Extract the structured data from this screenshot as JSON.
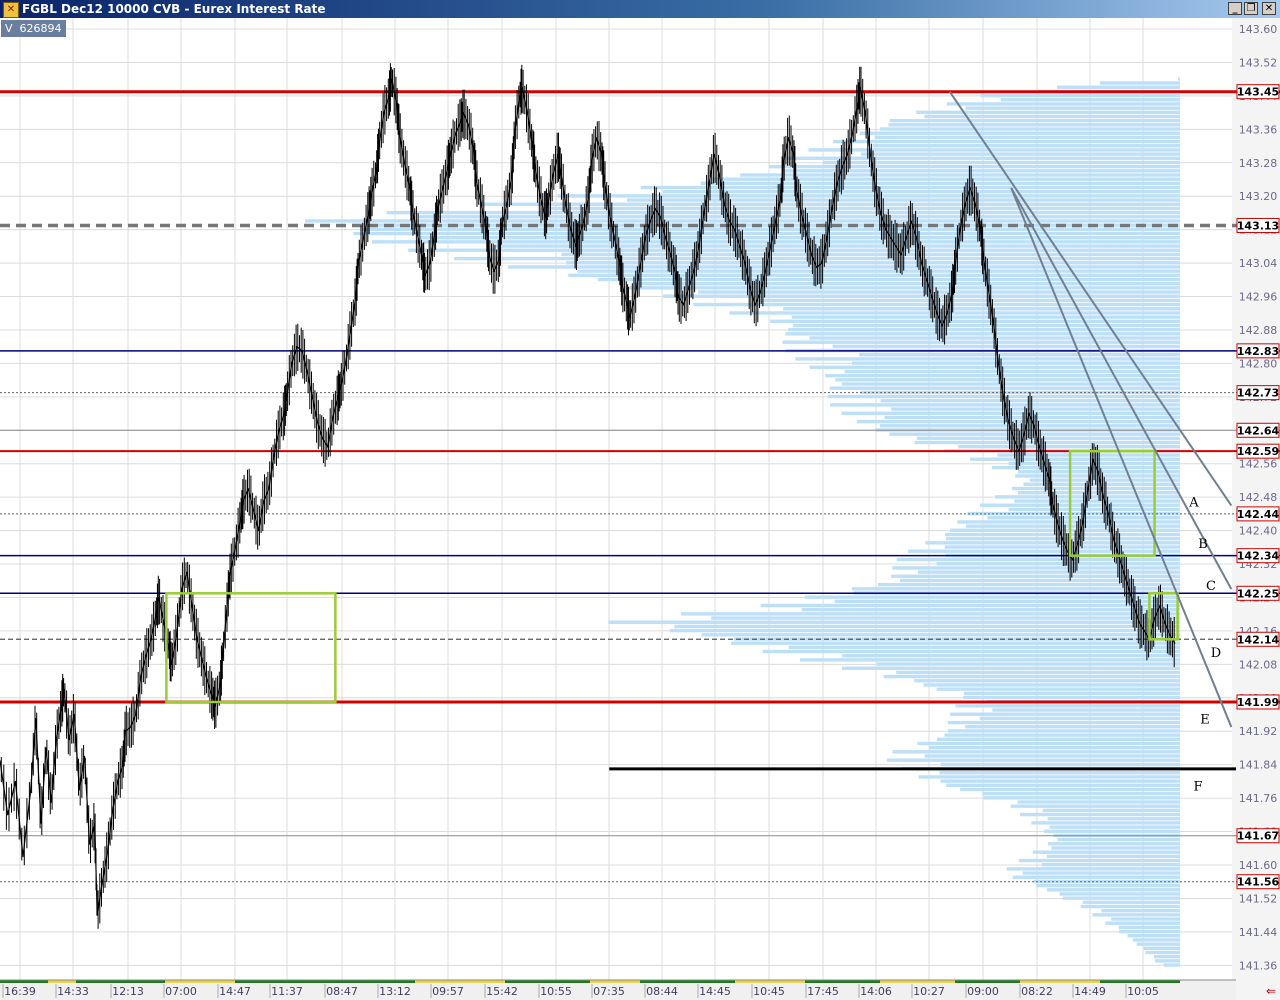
{
  "window": {
    "title": "FGBL Dec12 10000 CVB - Eurex Interest Rate",
    "buttons": {
      "minimize": "_",
      "restore": "❐",
      "close": "✕"
    }
  },
  "volume_badge": {
    "label": "V",
    "value": "626894"
  },
  "colors": {
    "grid": "#dcdcdc",
    "price": "#000000",
    "profile": "#bde0f8",
    "red_line": "#d40000",
    "blue_line": "#000080",
    "box": "#9acd32",
    "trend": "#708090",
    "tag_bg": "#ffffff",
    "tag_border": "#cc0000",
    "time_green": "#1e7b1e",
    "time_yellow": "#e8d44d"
  },
  "chart_data": {
    "type": "line",
    "symbol": "FGBL Dec12",
    "bar_type": "10000 CVB",
    "ylim": [
      141.31,
      143.63
    ],
    "y_ticks": [
      143.6,
      143.52,
      143.44,
      143.36,
      143.28,
      143.2,
      143.12,
      143.04,
      142.96,
      142.88,
      142.8,
      142.72,
      142.64,
      142.56,
      142.48,
      142.4,
      142.32,
      142.24,
      142.16,
      142.08,
      142.0,
      141.92,
      141.84,
      141.76,
      141.68,
      141.6,
      141.52,
      141.44,
      141.36
    ],
    "y_tick_labels": [
      "143.60",
      "143.52",
      "143.44",
      "143.36",
      "143.28",
      "143.20",
      "143.12",
      "143.04",
      "142.96",
      "142.88",
      "142.80",
      "142.72",
      "142.64",
      "142.56",
      "142.48",
      "142.40",
      "142.32",
      "142.24",
      "142.16",
      "142.08",
      "142.00",
      "141.92",
      "141.84",
      "141.76",
      "141.68",
      "141.60",
      "141.52",
      "141.44",
      "141.36"
    ],
    "x_labels": [
      "16:39",
      "14:33",
      "12:13",
      "07:00",
      "14:47",
      "11:37",
      "08:47",
      "13:12",
      "09:57",
      "15:42",
      "10:55",
      "07:35",
      "08:44",
      "14:45",
      "10:45",
      "17:45",
      "14:06",
      "10:27",
      "09:00",
      "08:22",
      "14:49",
      "10:05"
    ],
    "price_path": [
      [
        0,
        141.85
      ],
      [
        3,
        141.72
      ],
      [
        6,
        141.8
      ],
      [
        9,
        141.62
      ],
      [
        12,
        141.78
      ],
      [
        14,
        141.95
      ],
      [
        16,
        141.7
      ],
      [
        18,
        141.88
      ],
      [
        20,
        141.75
      ],
      [
        22,
        141.9
      ],
      [
        24,
        141.98
      ],
      [
        25,
        142.02
      ],
      [
        27,
        141.9
      ],
      [
        29,
        141.96
      ],
      [
        31,
        141.78
      ],
      [
        33,
        141.86
      ],
      [
        35,
        141.65
      ],
      [
        37,
        141.7
      ],
      [
        38,
        141.48
      ],
      [
        40,
        141.56
      ],
      [
        42,
        141.63
      ],
      [
        44,
        141.73
      ],
      [
        46,
        141.8
      ],
      [
        48,
        141.84
      ],
      [
        49,
        141.92
      ],
      [
        51,
        141.93
      ],
      [
        53,
        141.96
      ],
      [
        55,
        142.05
      ],
      [
        57,
        142.1
      ],
      [
        59,
        142.14
      ],
      [
        61,
        142.2
      ],
      [
        62,
        142.24
      ],
      [
        64,
        142.18
      ],
      [
        66,
        142.12
      ],
      [
        67,
        142.08
      ],
      [
        69,
        142.15
      ],
      [
        71,
        142.26
      ],
      [
        73,
        142.3
      ],
      [
        75,
        142.22
      ],
      [
        77,
        142.14
      ],
      [
        79,
        142.09
      ],
      [
        81,
        142.04
      ],
      [
        83,
        142.0
      ],
      [
        84,
        141.98
      ],
      [
        86,
        142.03
      ],
      [
        87,
        142.1
      ],
      [
        89,
        142.24
      ],
      [
        90,
        142.3
      ],
      [
        92,
        142.36
      ],
      [
        94,
        142.43
      ],
      [
        95,
        142.47
      ],
      [
        97,
        142.5
      ],
      [
        99,
        142.45
      ],
      [
        101,
        142.4
      ],
      [
        103,
        142.47
      ],
      [
        105,
        142.5
      ],
      [
        107,
        142.58
      ],
      [
        109,
        142.64
      ],
      [
        111,
        142.68
      ],
      [
        112,
        142.72
      ],
      [
        114,
        142.8
      ],
      [
        116,
        142.84
      ],
      [
        118,
        142.83
      ],
      [
        120,
        142.78
      ],
      [
        122,
        142.72
      ],
      [
        124,
        142.66
      ],
      [
        126,
        142.62
      ],
      [
        128,
        142.6
      ],
      [
        130,
        142.67
      ],
      [
        132,
        142.72
      ],
      [
        133,
        142.74
      ],
      [
        135,
        142.8
      ],
      [
        137,
        142.88
      ],
      [
        139,
        142.96
      ],
      [
        140,
        143.04
      ],
      [
        142,
        143.1
      ],
      [
        144,
        143.16
      ],
      [
        145,
        143.2
      ],
      [
        147,
        143.26
      ],
      [
        148,
        143.32
      ],
      [
        150,
        143.4
      ],
      [
        152,
        143.44
      ],
      [
        153,
        143.48
      ],
      [
        155,
        143.42
      ],
      [
        156,
        143.35
      ],
      [
        158,
        143.28
      ],
      [
        160,
        143.22
      ],
      [
        161,
        143.17
      ],
      [
        163,
        143.11
      ],
      [
        165,
        143.05
      ],
      [
        166,
        143.01
      ],
      [
        168,
        143.04
      ],
      [
        170,
        143.12
      ],
      [
        171,
        143.17
      ],
      [
        173,
        143.22
      ],
      [
        175,
        143.27
      ],
      [
        176,
        143.3
      ],
      [
        178,
        143.35
      ],
      [
        180,
        143.38
      ],
      [
        181,
        143.4
      ],
      [
        183,
        143.37
      ],
      [
        185,
        143.31
      ],
      [
        186,
        143.24
      ],
      [
        188,
        143.18
      ],
      [
        190,
        143.12
      ],
      [
        191,
        143.06
      ],
      [
        193,
        143.02
      ],
      [
        195,
        143.05
      ],
      [
        196,
        143.13
      ],
      [
        198,
        143.18
      ],
      [
        200,
        143.25
      ],
      [
        201,
        143.35
      ],
      [
        203,
        143.44
      ],
      [
        204,
        143.46
      ],
      [
        206,
        143.4
      ],
      [
        208,
        143.32
      ],
      [
        209,
        143.27
      ],
      [
        211,
        143.2
      ],
      [
        213,
        143.15
      ],
      [
        214,
        143.18
      ],
      [
        216,
        143.25
      ],
      [
        218,
        143.3
      ],
      [
        219,
        143.26
      ],
      [
        221,
        143.18
      ],
      [
        223,
        143.12
      ],
      [
        225,
        143.08
      ],
      [
        226,
        143.1
      ],
      [
        228,
        143.14
      ],
      [
        230,
        143.2
      ],
      [
        231,
        143.28
      ],
      [
        233,
        143.34
      ],
      [
        235,
        143.3
      ],
      [
        236,
        143.24
      ],
      [
        238,
        143.16
      ],
      [
        240,
        143.1
      ],
      [
        242,
        143.04
      ],
      [
        243,
        142.99
      ],
      [
        245,
        142.94
      ],
      [
        246,
        142.91
      ],
      [
        248,
        142.96
      ],
      [
        250,
        143.03
      ],
      [
        252,
        143.1
      ],
      [
        254,
        143.14
      ],
      [
        256,
        143.17
      ],
      [
        258,
        143.15
      ],
      [
        260,
        143.1
      ],
      [
        262,
        143.06
      ],
      [
        264,
        143.01
      ],
      [
        265,
        142.96
      ],
      [
        267,
        142.94
      ],
      [
        269,
        142.98
      ],
      [
        271,
        143.02
      ],
      [
        273,
        143.08
      ],
      [
        275,
        143.16
      ],
      [
        277,
        143.23
      ],
      [
        279,
        143.3
      ],
      [
        281,
        143.25
      ],
      [
        283,
        143.18
      ],
      [
        285,
        143.14
      ],
      [
        287,
        143.12
      ],
      [
        289,
        143.08
      ],
      [
        291,
        143.04
      ],
      [
        293,
        142.98
      ],
      [
        295,
        142.94
      ],
      [
        297,
        142.97
      ],
      [
        299,
        143.02
      ],
      [
        301,
        143.08
      ],
      [
        303,
        143.14
      ],
      [
        305,
        143.2
      ],
      [
        306,
        143.28
      ],
      [
        308,
        143.34
      ],
      [
        310,
        143.3
      ],
      [
        311,
        143.22
      ],
      [
        313,
        143.16
      ],
      [
        315,
        143.11
      ],
      [
        317,
        143.06
      ],
      [
        319,
        143.03
      ],
      [
        321,
        143.04
      ],
      [
        323,
        143.1
      ],
      [
        325,
        143.17
      ],
      [
        327,
        143.23
      ],
      [
        329,
        143.27
      ],
      [
        331,
        143.3
      ],
      [
        333,
        143.35
      ],
      [
        335,
        143.42
      ],
      [
        336,
        143.46
      ],
      [
        338,
        143.4
      ],
      [
        340,
        143.3
      ],
      [
        342,
        143.22
      ],
      [
        344,
        143.16
      ],
      [
        346,
        143.12
      ],
      [
        348,
        143.1
      ],
      [
        350,
        143.08
      ],
      [
        352,
        143.06
      ],
      [
        354,
        143.1
      ],
      [
        356,
        143.14
      ],
      [
        358,
        143.1
      ],
      [
        360,
        143.04
      ],
      [
        362,
        143.0
      ],
      [
        364,
        142.96
      ],
      [
        366,
        142.92
      ],
      [
        368,
        142.89
      ],
      [
        370,
        142.92
      ],
      [
        372,
        142.97
      ],
      [
        373,
        143.03
      ],
      [
        375,
        143.12
      ],
      [
        377,
        143.18
      ],
      [
        379,
        143.22
      ],
      [
        381,
        143.18
      ],
      [
        383,
        143.12
      ],
      [
        384,
        143.06
      ],
      [
        386,
        142.98
      ],
      [
        388,
        142.9
      ],
      [
        390,
        142.8
      ],
      [
        392,
        142.72
      ],
      [
        394,
        142.66
      ],
      [
        396,
        142.62
      ],
      [
        398,
        142.59
      ],
      [
        400,
        142.63
      ],
      [
        402,
        142.68
      ],
      [
        404,
        142.65
      ],
      [
        406,
        142.6
      ],
      [
        408,
        142.56
      ],
      [
        410,
        142.52
      ],
      [
        411,
        142.47
      ],
      [
        413,
        142.42
      ],
      [
        415,
        142.38
      ],
      [
        417,
        142.35
      ],
      [
        419,
        142.33
      ],
      [
        421,
        142.37
      ],
      [
        423,
        142.42
      ],
      [
        425,
        142.5
      ],
      [
        427,
        142.57
      ],
      [
        429,
        142.54
      ],
      [
        431,
        142.48
      ],
      [
        433,
        142.44
      ],
      [
        435,
        142.38
      ],
      [
        437,
        142.34
      ],
      [
        439,
        142.3
      ],
      [
        441,
        142.26
      ],
      [
        443,
        142.22
      ],
      [
        445,
        142.18
      ],
      [
        447,
        142.16
      ],
      [
        449,
        142.14
      ],
      [
        451,
        142.19
      ],
      [
        453,
        142.22
      ],
      [
        455,
        142.18
      ],
      [
        457,
        142.15
      ],
      [
        459,
        142.13
      ]
    ],
    "price_path_units": "x = bar index (0-459), y = price",
    "horizontal_levels": [
      {
        "price": 143.45,
        "label": "143.45",
        "style": "red-thick"
      },
      {
        "price": 143.13,
        "label": "143.13",
        "style": "gray-dashed-thick"
      },
      {
        "price": 142.83,
        "label": "142.83",
        "style": "blue"
      },
      {
        "price": 142.73,
        "label": "142.73",
        "style": "dotted"
      },
      {
        "price": 142.64,
        "label": "142.64",
        "style": "gray-thin"
      },
      {
        "price": 142.59,
        "label": "142.59",
        "style": "red"
      },
      {
        "price": 142.44,
        "label": "142.44",
        "style": "dotted"
      },
      {
        "price": 142.34,
        "label": "142.34",
        "style": "blue"
      },
      {
        "price": 142.25,
        "label": "142.25",
        "style": "blue"
      },
      {
        "price": 142.14,
        "label": "142.14",
        "style": "gray-dashed"
      },
      {
        "price": 141.99,
        "label": "141.99",
        "style": "red-thick"
      },
      {
        "price": 141.83,
        "label": "",
        "style": "black-thick-partial",
        "from_bar": 238
      },
      {
        "price": 141.67,
        "label": "141.67",
        "style": "gray-thin"
      },
      {
        "price": 141.56,
        "label": "141.56",
        "style": "dotted"
      }
    ],
    "boxes": [
      {
        "bar_from": 65,
        "bar_to": 131,
        "price_top": 142.25,
        "price_bottom": 141.99
      },
      {
        "bar_from": 418,
        "bar_to": 451,
        "price_top": 142.59,
        "price_bottom": 142.34
      },
      {
        "bar_from": 449,
        "bar_to": 460,
        "price_top": 142.25,
        "price_bottom": 142.14
      }
    ],
    "trendlines": [
      {
        "from": [
          371,
          143.45
        ],
        "to": [
          481,
          142.46
        ]
      },
      {
        "from": [
          395,
          143.22
        ],
        "to": [
          481,
          142.26
        ]
      },
      {
        "from": [
          395,
          143.22
        ],
        "to": [
          481,
          141.93
        ]
      }
    ],
    "annotations": [
      {
        "text": "A",
        "price": 142.47
      },
      {
        "text": "B",
        "price": 142.37
      },
      {
        "text": "C",
        "price": 142.27
      },
      {
        "text": "D",
        "price": 142.11
      },
      {
        "text": "E",
        "price": 141.95
      },
      {
        "text": "F",
        "price": 141.79
      }
    ],
    "volume_profile": {
      "price_from": 141.36,
      "price_to": 143.48,
      "step": 0.01,
      "anchors": [
        [
          141.36,
          0.02
        ],
        [
          141.42,
          0.05
        ],
        [
          141.5,
          0.1
        ],
        [
          141.58,
          0.18
        ],
        [
          141.66,
          0.13
        ],
        [
          141.74,
          0.17
        ],
        [
          141.8,
          0.26
        ],
        [
          141.86,
          0.3
        ],
        [
          141.92,
          0.24
        ],
        [
          142.0,
          0.22
        ],
        [
          142.06,
          0.32
        ],
        [
          142.1,
          0.4
        ],
        [
          142.14,
          0.48
        ],
        [
          142.18,
          0.58
        ],
        [
          142.22,
          0.42
        ],
        [
          142.28,
          0.3
        ],
        [
          142.34,
          0.28
        ],
        [
          142.4,
          0.24
        ],
        [
          142.46,
          0.2
        ],
        [
          142.52,
          0.16
        ],
        [
          142.58,
          0.22
        ],
        [
          142.64,
          0.32
        ],
        [
          142.7,
          0.35
        ],
        [
          142.78,
          0.37
        ],
        [
          142.84,
          0.4
        ],
        [
          142.9,
          0.42
        ],
        [
          142.96,
          0.52
        ],
        [
          143.02,
          0.66
        ],
        [
          143.06,
          0.75
        ],
        [
          143.1,
          0.84
        ],
        [
          143.14,
          0.9
        ],
        [
          143.18,
          0.7
        ],
        [
          143.22,
          0.55
        ],
        [
          143.26,
          0.43
        ],
        [
          143.32,
          0.36
        ],
        [
          143.38,
          0.3
        ],
        [
          143.44,
          0.2
        ],
        [
          143.48,
          0.05
        ]
      ],
      "anchor_units": "[price, fraction of max width]"
    }
  }
}
